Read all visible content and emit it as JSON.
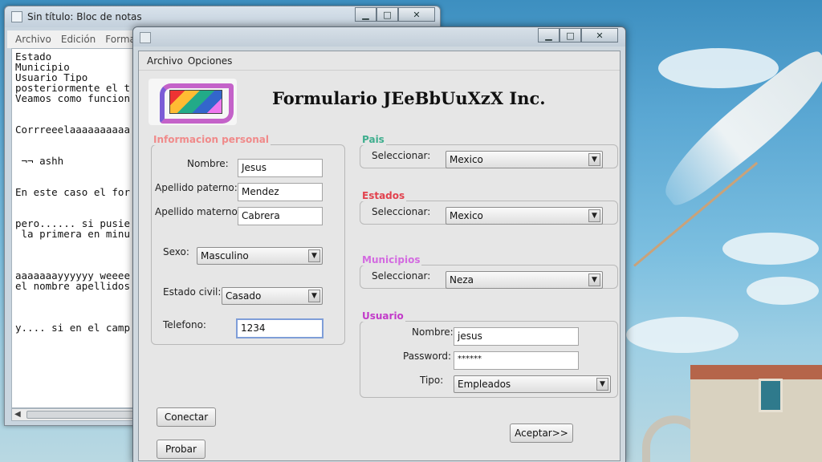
{
  "notepad": {
    "title": "Sin título: Bloc de notas",
    "menu": [
      "Archivo",
      "Edición",
      "Formato"
    ],
    "lines": [
      "Estado",
      "Municipio",
      "Usuario Tipo",
      "posteriormente el t",
      "Veamos como funcion",
      "",
      "",
      "Corrreeelaaaaaaaaaa",
      "",
      "",
      " ¬¬ ashh",
      "",
      "",
      "En este caso el for",
      "",
      "",
      "pero...... si pusie",
      " la primera en minu",
      "",
      "",
      "",
      "aaaaaaayyyyyy weeee",
      "el nombre apellidos",
      "",
      "",
      "",
      "y.... si en el camp"
    ]
  },
  "form": {
    "menu": [
      "Archivo",
      "Opciones"
    ],
    "title": "Formulario JEeBbUuXzX Inc.",
    "personal": {
      "title": "Informacion personal",
      "nombre_label": "Nombre:",
      "nombre": "Jesus",
      "paterno_label": "Apellido paterno:",
      "paterno": "Mendez",
      "materno_label": "Apellido materno:",
      "materno": "Cabrera",
      "sexo_label": "Sexo:",
      "sexo": "Masculino",
      "civil_label": "Estado civil:",
      "civil": "Casado",
      "telefono_label": "Telefono:",
      "telefono": "1234"
    },
    "pais": {
      "title": "Pais",
      "label": "Seleccionar:",
      "value": "Mexico"
    },
    "estados": {
      "title": "Estados",
      "label": "Seleccionar:",
      "value": "Mexico"
    },
    "municipios": {
      "title": "Municipios",
      "label": "Seleccionar:",
      "value": "Neza"
    },
    "usuario": {
      "title": "Usuario",
      "nombre_label": "Nombre:",
      "nombre": "jesus",
      "password_label": "Password:",
      "password": "******",
      "tipo_label": "Tipo:",
      "tipo": "Empleados"
    },
    "buttons": {
      "conectar": "Conectar",
      "probar": "Probar",
      "aceptar": "Aceptar>>"
    },
    "colors": {
      "personal_title": "#f08a8a",
      "pais_title": "#3fae8e",
      "estados_title": "#e2424e",
      "municipios_title": "#d36be0",
      "usuario_title": "#c23ac9"
    }
  }
}
